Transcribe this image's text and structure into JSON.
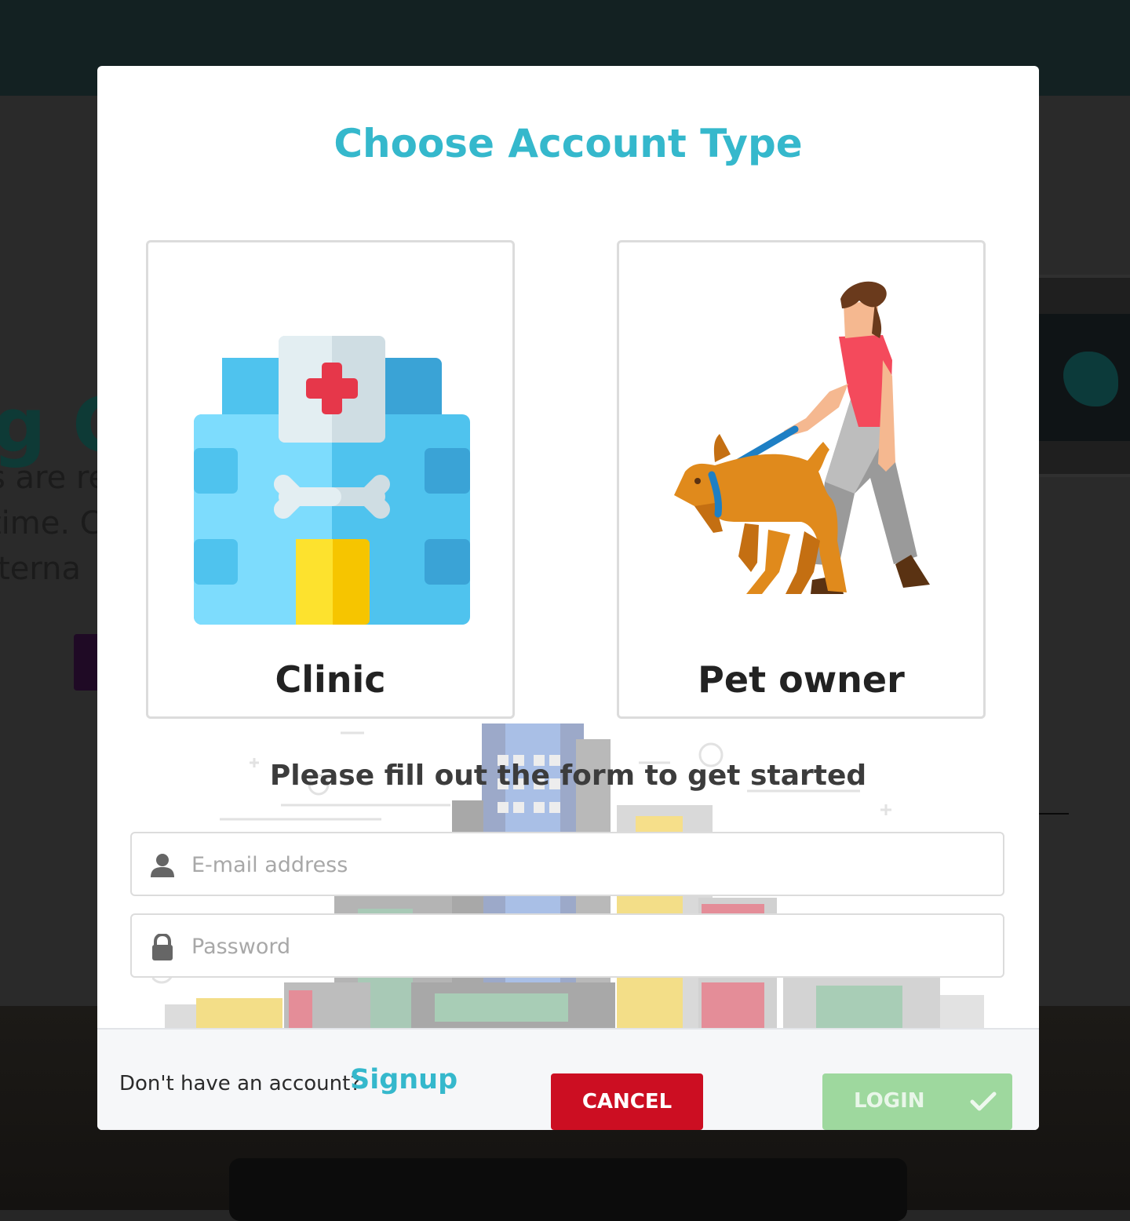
{
  "background": {
    "hero_title": "g C",
    "hero_lines": [
      "s are re",
      "time. C",
      "lterna"
    ]
  },
  "modal": {
    "title": "Choose Account Type",
    "options": [
      {
        "label": "Clinic",
        "icon": "clinic-building-icon"
      },
      {
        "label": "Pet owner",
        "icon": "person-walking-dog-icon"
      }
    ],
    "tagline": "Please fill out the form to get started",
    "email": {
      "placeholder": "E-mail address",
      "value": "",
      "icon": "user-icon"
    },
    "password": {
      "placeholder": "Password",
      "value": "",
      "icon": "lock-icon"
    }
  },
  "footer": {
    "prompt": "Don't have an account?",
    "signup": "Signup",
    "cancel": "CANCEL",
    "login": "LOGIN",
    "login_icon": "checkmark-icon"
  },
  "colors": {
    "accent": "#35b8cc",
    "cancel": "#cc0e22",
    "login_disabled": "#9ed89e",
    "overlay": "#262626"
  }
}
